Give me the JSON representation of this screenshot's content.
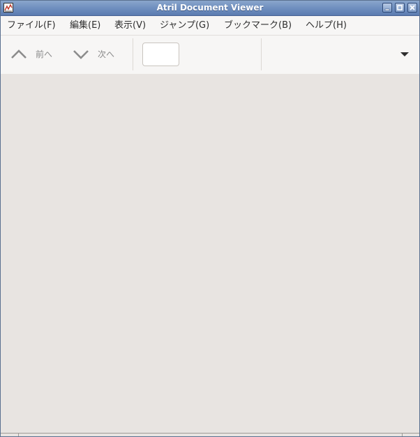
{
  "window": {
    "title": "Atril Document Viewer"
  },
  "menubar": {
    "items": [
      {
        "label": "ファイル(F)"
      },
      {
        "label": "編集(E)"
      },
      {
        "label": "表示(V)"
      },
      {
        "label": "ジャンプ(G)"
      },
      {
        "label": "ブックマーク(B)"
      },
      {
        "label": "ヘルプ(H)"
      }
    ]
  },
  "toolbar": {
    "prev_label": "前へ",
    "next_label": "次へ",
    "page_entry_value": "",
    "prev_icon": "chevron-up-icon",
    "next_icon": "chevron-down-icon",
    "menu_icon": "dropdown-arrow-icon"
  },
  "colors": {
    "titlebar": "#6f8fbf",
    "background": "#e8e4e1",
    "toolbar": "#f7f6f5"
  }
}
